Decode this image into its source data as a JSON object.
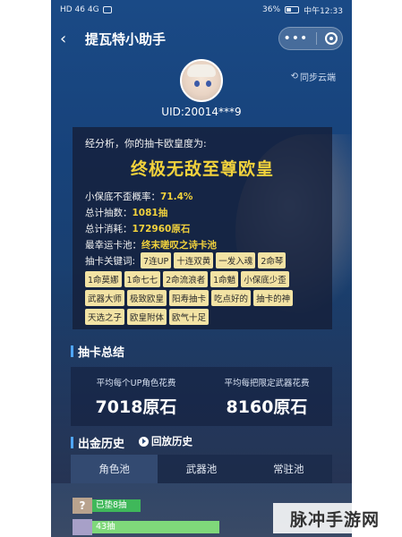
{
  "status_bar": {
    "left": "HD 46 4G",
    "battery": "36%",
    "time": "中午12:33"
  },
  "nav": {
    "title": "提瓦特小助手",
    "back_icon": "chevron-left-icon",
    "more_icon": "more-dots-icon",
    "close_icon": "target-close-icon"
  },
  "profile": {
    "sync_label": "同步云端",
    "uid": "UID:20014***9"
  },
  "analysis": {
    "intro": "经分析，你的抽卡欧皇度为:",
    "verdict": "终极无敌至尊欧皇",
    "stats": [
      {
        "label": "小保底不歪概率：",
        "value": "71.4%"
      },
      {
        "label": "总计抽数：",
        "value": "1081抽"
      },
      {
        "label": "总计消耗：",
        "value": "172960原石"
      },
      {
        "label": "最幸运卡池：",
        "value": "终末嗟叹之诗卡池"
      }
    ],
    "keyword_title": "抽卡关键词:",
    "keywords_row1": [
      "7连UP",
      "十连双黄",
      "一发入魂",
      "2命琴"
    ],
    "keywords_row2": [
      "1命莫娜",
      "1命七七",
      "2命流浪者",
      "1命魈",
      "小保底少歪"
    ],
    "keywords_row3": [
      "武器大师",
      "极致欧皇",
      "阳寿抽卡",
      "吃点好的",
      "抽卡的神"
    ],
    "keywords_row4": [
      "天选之子",
      "欧皇附体",
      "欧气十足"
    ]
  },
  "summary": {
    "title": "抽卡总结",
    "left_label": "平均每个UP角色花费",
    "left_value": "7018原石",
    "right_label": "平均每把限定武器花费",
    "right_value": "8160原石"
  },
  "history": {
    "title": "出金历史",
    "playback_label": "回放历史",
    "tabs": [
      "角色池",
      "武器池",
      "常驻池"
    ],
    "rows": [
      {
        "thumb": "?",
        "label": "已垫8抽"
      },
      {
        "thumb": "",
        "label": "43抽"
      }
    ]
  },
  "watermark": "脉冲手游网"
}
